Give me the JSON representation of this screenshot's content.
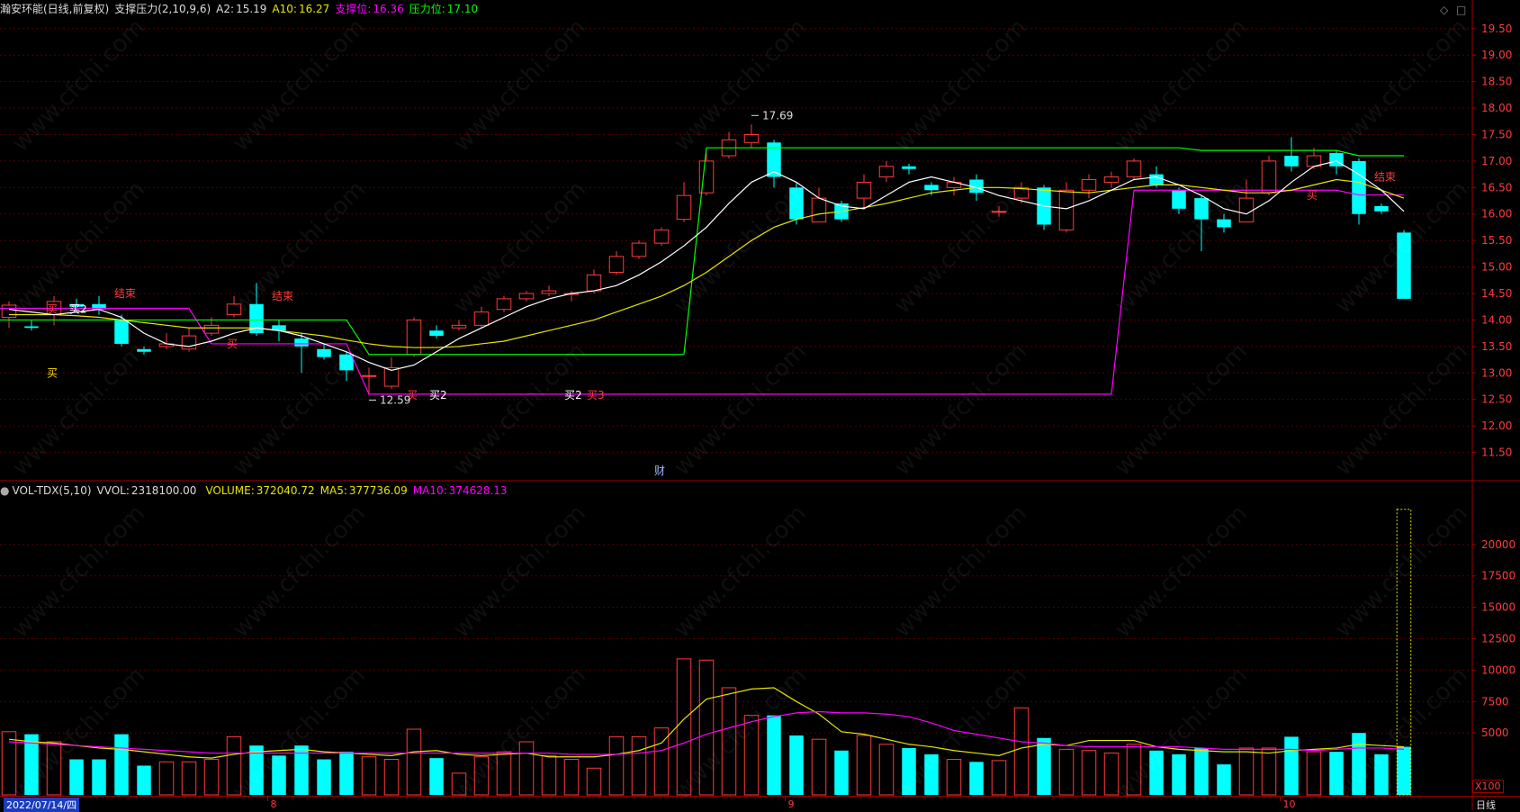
{
  "price_header": {
    "title": "瀚安环能(日线,前复权)",
    "indicator": "支撑压力(2,10,9,6)",
    "a2_label": "A2:",
    "a2_value": "15.19",
    "a10_label": "A10:",
    "a10_value": "16.27",
    "support_label": "支撑位:",
    "support_value": "16.36",
    "pressure_label": "压力位:",
    "pressure_value": "17.10"
  },
  "volume_header": {
    "title": "VOL-TDX(5,10)",
    "vvol_label": "VVOL:",
    "vvol_value": "2318100.00",
    "volume_label": "VOLUME:",
    "volume_value": "372040.72",
    "ma5_label": "MA5:",
    "ma5_value": "377736.09",
    "ma10_label": "MA10:",
    "ma10_value": "374628.13"
  },
  "bottom_bar": {
    "start_date": "2022/07/14/四",
    "period": "日线",
    "unit": "X100"
  },
  "watermark": "www.cfchi.com",
  "colors": {
    "up": "#ff3b3b",
    "down": "#00ffff",
    "ma_short": "#ffffff",
    "ma_long": "#e6e600",
    "support": "#ff00ff",
    "pressure": "#00ff00",
    "grid": "#5a0000",
    "axis": "#a00000"
  },
  "chart_data": {
    "type": "candlestick",
    "price_axis": {
      "ticks": [
        "19.50",
        "19.00",
        "18.50",
        "18.00",
        "17.50",
        "17.00",
        "16.50",
        "16.00",
        "15.50",
        "15.00",
        "14.50",
        "14.00",
        "13.50",
        "13.00",
        "12.50",
        "12.00",
        "11.50"
      ],
      "range": [
        11.0,
        19.7
      ]
    },
    "volume_axis": {
      "ticks": [
        "20000",
        "17500",
        "15000",
        "12500",
        "10000",
        "7500",
        "5000"
      ],
      "range": [
        0,
        23500
      ]
    },
    "month_labels": [
      {
        "label": "8",
        "index": 12
      },
      {
        "label": "9",
        "index": 35
      },
      {
        "label": "10",
        "index": 57
      }
    ],
    "candles": [
      [
        14.05,
        14.28,
        14.35,
        13.85
      ],
      [
        13.88,
        13.85,
        14.0,
        13.8
      ],
      [
        14.1,
        14.35,
        14.45,
        13.9
      ],
      [
        14.3,
        14.25,
        14.4,
        14.15
      ],
      [
        14.3,
        14.2,
        14.45,
        14.1
      ],
      [
        14.0,
        13.55,
        14.1,
        13.5
      ],
      [
        13.45,
        13.4,
        13.5,
        13.35
      ],
      [
        13.5,
        13.55,
        13.75,
        13.45
      ],
      [
        13.45,
        13.7,
        13.85,
        13.4
      ],
      [
        13.75,
        13.9,
        14.05,
        13.7
      ],
      [
        14.1,
        14.3,
        14.45,
        14.05
      ],
      [
        14.3,
        13.75,
        14.7,
        13.7
      ],
      [
        13.9,
        13.8,
        14.0,
        13.6
      ],
      [
        13.65,
        13.5,
        13.75,
        13.0
      ],
      [
        13.45,
        13.3,
        13.55,
        13.25
      ],
      [
        13.35,
        13.05,
        13.4,
        12.85
      ],
      [
        12.95,
        12.95,
        13.1,
        12.59
      ],
      [
        12.75,
        13.1,
        13.3,
        12.7
      ],
      [
        13.35,
        14.0,
        14.05,
        13.3
      ],
      [
        13.8,
        13.7,
        13.9,
        13.65
      ],
      [
        13.85,
        13.9,
        14.0,
        13.8
      ],
      [
        13.9,
        14.15,
        14.25,
        13.85
      ],
      [
        14.2,
        14.4,
        14.45,
        14.15
      ],
      [
        14.4,
        14.5,
        14.55,
        14.35
      ],
      [
        14.5,
        14.55,
        14.65,
        14.45
      ],
      [
        14.5,
        14.5,
        14.55,
        14.35
      ],
      [
        14.55,
        14.85,
        14.95,
        14.5
      ],
      [
        14.9,
        15.2,
        15.3,
        14.85
      ],
      [
        15.2,
        15.45,
        15.5,
        15.15
      ],
      [
        15.45,
        15.7,
        15.75,
        15.4
      ],
      [
        15.9,
        16.35,
        16.6,
        15.85
      ],
      [
        16.4,
        17.0,
        17.15,
        16.35
      ],
      [
        17.1,
        17.4,
        17.55,
        17.05
      ],
      [
        17.35,
        17.5,
        17.69,
        17.25
      ],
      [
        17.35,
        16.7,
        17.4,
        16.5
      ],
      [
        16.5,
        15.9,
        16.6,
        15.8
      ],
      [
        15.85,
        16.3,
        16.5,
        15.85
      ],
      [
        16.2,
        15.9,
        16.25,
        15.85
      ],
      [
        16.3,
        16.6,
        16.75,
        16.1
      ],
      [
        16.7,
        16.9,
        17.0,
        16.6
      ],
      [
        16.9,
        16.85,
        16.95,
        16.75
      ],
      [
        16.55,
        16.45,
        16.6,
        16.35
      ],
      [
        16.5,
        16.6,
        16.7,
        16.35
      ],
      [
        16.65,
        16.4,
        16.75,
        16.25
      ],
      [
        16.05,
        16.05,
        16.15,
        15.95
      ],
      [
        16.3,
        16.5,
        16.6,
        16.2
      ],
      [
        16.5,
        15.8,
        16.55,
        15.7
      ],
      [
        15.7,
        16.45,
        16.6,
        15.65
      ],
      [
        16.45,
        16.65,
        16.75,
        16.3
      ],
      [
        16.6,
        16.7,
        16.8,
        16.5
      ],
      [
        16.7,
        17.0,
        17.05,
        16.65
      ],
      [
        16.75,
        16.55,
        16.9,
        16.5
      ],
      [
        16.45,
        16.1,
        16.5,
        16.0
      ],
      [
        16.3,
        15.9,
        16.35,
        15.3
      ],
      [
        15.9,
        15.75,
        16.0,
        15.65
      ],
      [
        15.85,
        16.3,
        16.65,
        15.85
      ],
      [
        16.4,
        17.0,
        17.1,
        16.35
      ],
      [
        17.1,
        16.9,
        17.45,
        16.8
      ],
      [
        16.9,
        17.1,
        17.25,
        16.85
      ],
      [
        17.15,
        16.9,
        17.2,
        16.75
      ],
      [
        17.0,
        16.0,
        17.05,
        15.8
      ],
      [
        16.15,
        16.05,
        16.2,
        16.0
      ],
      [
        15.65,
        14.4,
        15.7,
        14.4
      ]
    ],
    "ma_short": [
      14.2,
      14.15,
      14.1,
      14.15,
      14.2,
      14.05,
      13.75,
      13.55,
      13.5,
      13.6,
      13.75,
      13.85,
      13.8,
      13.7,
      13.55,
      13.4,
      13.2,
      13.05,
      13.15,
      13.4,
      13.65,
      13.85,
      14.05,
      14.25,
      14.4,
      14.5,
      14.55,
      14.65,
      14.85,
      15.1,
      15.4,
      15.75,
      16.2,
      16.6,
      16.8,
      16.6,
      16.3,
      16.15,
      16.1,
      16.35,
      16.6,
      16.7,
      16.6,
      16.5,
      16.35,
      16.25,
      16.15,
      16.1,
      16.25,
      16.45,
      16.65,
      16.7,
      16.55,
      16.35,
      16.1,
      16.0,
      16.25,
      16.6,
      16.9,
      17.0,
      16.75,
      16.45,
      16.05
    ],
    "ma_long": [
      14.1,
      14.1,
      14.1,
      14.08,
      14.05,
      14.0,
      13.95,
      13.9,
      13.85,
      13.85,
      13.85,
      13.85,
      13.8,
      13.75,
      13.7,
      13.62,
      13.55,
      13.5,
      13.48,
      13.48,
      13.5,
      13.55,
      13.6,
      13.7,
      13.8,
      13.9,
      14.0,
      14.15,
      14.3,
      14.45,
      14.65,
      14.9,
      15.2,
      15.5,
      15.75,
      15.9,
      16.0,
      16.05,
      16.12,
      16.2,
      16.3,
      16.4,
      16.45,
      16.5,
      16.5,
      16.48,
      16.45,
      16.42,
      16.4,
      16.45,
      16.5,
      16.55,
      16.55,
      16.5,
      16.45,
      16.4,
      16.4,
      16.45,
      16.55,
      16.65,
      16.6,
      16.45,
      16.3
    ],
    "support_line": [
      14.22,
      14.22,
      14.22,
      14.22,
      14.22,
      14.22,
      14.22,
      14.22,
      14.22,
      13.55,
      13.55,
      13.55,
      13.55,
      13.55,
      13.55,
      13.55,
      12.6,
      12.6,
      12.6,
      12.6,
      12.6,
      12.6,
      12.6,
      12.6,
      12.6,
      12.6,
      12.6,
      12.6,
      12.6,
      12.6,
      12.6,
      12.6,
      12.6,
      12.6,
      12.6,
      12.6,
      12.6,
      12.6,
      12.6,
      12.6,
      12.6,
      12.6,
      12.6,
      12.6,
      12.6,
      12.6,
      12.6,
      12.6,
      12.6,
      12.6,
      16.45,
      16.45,
      16.45,
      16.45,
      16.45,
      16.45,
      16.45,
      16.45,
      16.45,
      16.45,
      16.36,
      16.36,
      16.36
    ],
    "pressure_line": [
      14.0,
      14.0,
      14.0,
      14.0,
      14.0,
      14.0,
      14.0,
      14.0,
      14.0,
      14.0,
      14.0,
      14.0,
      14.0,
      14.0,
      14.0,
      14.0,
      13.35,
      13.35,
      13.35,
      13.35,
      13.35,
      13.35,
      13.35,
      13.35,
      13.35,
      13.35,
      13.35,
      13.35,
      13.35,
      13.35,
      13.35,
      17.25,
      17.25,
      17.25,
      17.25,
      17.25,
      17.25,
      17.25,
      17.25,
      17.25,
      17.25,
      17.25,
      17.25,
      17.25,
      17.25,
      17.25,
      17.25,
      17.25,
      17.25,
      17.25,
      17.25,
      17.25,
      17.25,
      17.2,
      17.2,
      17.2,
      17.2,
      17.2,
      17.2,
      17.2,
      17.1,
      17.1,
      17.1
    ],
    "volume": [
      5100,
      4900,
      4300,
      2900,
      2900,
      4900,
      2400,
      2700,
      2700,
      2900,
      4700,
      4000,
      3200,
      4000,
      2900,
      3500,
      3100,
      2900,
      5300,
      3000,
      1800,
      3100,
      3500,
      4300,
      3200,
      2900,
      2200,
      4700,
      4700,
      5400,
      10900,
      10800,
      8600,
      6400,
      6400,
      4800,
      4500,
      3600,
      4800,
      4100,
      3800,
      3300,
      2900,
      2700,
      2800,
      7000,
      4600,
      3700,
      3600,
      3400,
      4100,
      3600,
      3300,
      3800,
      2500,
      3800,
      3800,
      4700,
      3500,
      3500,
      5000,
      3300,
      3900
    ],
    "volume_ma5": [
      4500,
      4300,
      4200,
      4000,
      3800,
      3700,
      3500,
      3300,
      3100,
      3000,
      3300,
      3500,
      3600,
      3700,
      3500,
      3400,
      3300,
      3200,
      3500,
      3600,
      3300,
      3200,
      3300,
      3400,
      3100,
      3100,
      3100,
      3300,
      3600,
      4200,
      6100,
      7700,
      8100,
      8500,
      8600,
      7500,
      6500,
      5100,
      4900,
      4500,
      4100,
      3900,
      3600,
      3400,
      3200,
      3800,
      4100,
      4000,
      4400,
      4400,
      4400,
      3900,
      3700,
      3600,
      3500,
      3500,
      3400,
      3600,
      3700,
      3800,
      4100,
      4000,
      3900
    ],
    "volume_ma10": [
      4300,
      4200,
      4100,
      4000,
      3900,
      3800,
      3700,
      3600,
      3500,
      3400,
      3400,
      3400,
      3400,
      3400,
      3400,
      3400,
      3400,
      3400,
      3400,
      3400,
      3400,
      3400,
      3400,
      3400,
      3400,
      3300,
      3300,
      3300,
      3400,
      3600,
      4200,
      4900,
      5400,
      5900,
      6300,
      6600,
      6700,
      6600,
      6600,
      6500,
      6300,
      5800,
      5200,
      4900,
      4600,
      4300,
      4200,
      4000,
      3900,
      3900,
      3900,
      3900,
      3900,
      3800,
      3700,
      3700,
      3700,
      3700,
      3600,
      3700,
      3800,
      3800,
      3700
    ],
    "annotations": [
      {
        "text": "结束",
        "index": 5,
        "price": 14.5,
        "color": "#ff3b3b"
      },
      {
        "text": "结束",
        "index": 12,
        "price": 14.45,
        "color": "#ff3b3b"
      },
      {
        "text": "买",
        "index": 2,
        "price": 13.0,
        "color": "#ffd700"
      },
      {
        "text": "买",
        "index": 2,
        "price": 14.2,
        "color": "#ff3b3b"
      },
      {
        "text": "买2",
        "index": 3,
        "price": 14.2,
        "color": "#ffffff"
      },
      {
        "text": "买",
        "index": 10,
        "price": 13.55,
        "color": "#ff3b3b"
      },
      {
        "text": "买",
        "index": 18,
        "price": 12.58,
        "color": "#ff3b3b"
      },
      {
        "text": "买2",
        "index": 19,
        "price": 12.58,
        "color": "#ffffff"
      },
      {
        "text": "买2",
        "index": 25,
        "price": 12.58,
        "color": "#ffffff"
      },
      {
        "text": "买3",
        "index": 26,
        "price": 12.58,
        "color": "#ff3b3b"
      },
      {
        "text": "结束",
        "index": 61,
        "price": 16.7,
        "color": "#ff3b3b"
      },
      {
        "text": "买",
        "index": 58,
        "price": 16.35,
        "color": "#ff3b3b"
      },
      {
        "text": "财",
        "index": 29,
        "price": 11.15,
        "color": "#9fb8ff"
      }
    ],
    "extremes": [
      {
        "text": "17.69",
        "index": 33,
        "price": 17.69,
        "dir": "high"
      },
      {
        "text": "12.59",
        "index": 16,
        "price": 12.59,
        "dir": "low"
      }
    ]
  }
}
